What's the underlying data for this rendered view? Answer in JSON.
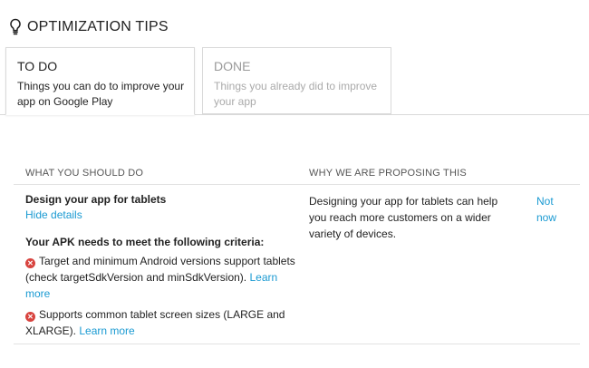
{
  "header": {
    "title": "OPTIMIZATION TIPS",
    "icon": "lightbulb-icon"
  },
  "tabs": [
    {
      "label": "TO DO",
      "description": "Things you can do to improve your app on Google Play",
      "active": true
    },
    {
      "label": "DONE",
      "description": "Things you already did to improve your app",
      "active": false
    }
  ],
  "table": {
    "col_what": "WHAT YOU SHOULD DO",
    "col_why": "WHY WE ARE PROPOSING THIS",
    "row": {
      "title": "Design your app for tablets",
      "hide_details": "Hide details",
      "criteria_heading": "Your APK needs to meet the following criteria:",
      "criteria": [
        {
          "text": "Target and minimum Android versions support tablets (check targetSdkVersion and minSdkVersion).",
          "link": "Learn more"
        },
        {
          "text": "Supports common tablet screen sizes (LARGE and XLARGE).",
          "link": "Learn more"
        }
      ],
      "reason": "Designing your app for tablets can help you reach more customers on a wider variety of devices.",
      "not_now": "Not now"
    }
  },
  "colors": {
    "link": "#1a9ad2",
    "error": "#d8443f",
    "border": "#d9d9d9"
  }
}
